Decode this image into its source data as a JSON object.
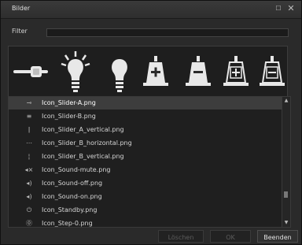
{
  "window": {
    "title": "Bilder"
  },
  "filter": {
    "label": "Filter",
    "value": ""
  },
  "icon_bar": {
    "icons": [
      "slider-handle-icon",
      "bulb-glowing-icon",
      "bulb-icon",
      "bell-plus-icon",
      "bell-minus-icon",
      "bell-plus-outline-icon",
      "bell-minus-outline-icon"
    ]
  },
  "files": [
    {
      "name": "Icon_Slider-A.png",
      "icon": "slider-a-icon",
      "glyph": "⊸",
      "selected": true
    },
    {
      "name": "Icon_Slider-B.png",
      "icon": "slider-b-icon",
      "glyph": "≡",
      "selected": false
    },
    {
      "name": "Icon_Slider_A_vertical.png",
      "icon": "slider-a-vertical-icon",
      "glyph": "ǀ",
      "selected": false
    },
    {
      "name": "Icon_Slider_B_horizontal.png",
      "icon": "slider-b-horizontal-icon",
      "glyph": "⋯",
      "selected": false
    },
    {
      "name": "Icon_Slider_B_vertical.png",
      "icon": "slider-b-vertical-icon",
      "glyph": "¦",
      "selected": false
    },
    {
      "name": "Icon_Sound-mute.png",
      "icon": "sound-mute-icon",
      "glyph": "◂×",
      "selected": false
    },
    {
      "name": "Icon_Sound-off.png",
      "icon": "sound-off-icon",
      "glyph": "◂)",
      "selected": false
    },
    {
      "name": "Icon_Sound-on.png",
      "icon": "sound-on-icon",
      "glyph": "◂)",
      "selected": false
    },
    {
      "name": "Icon_Standby.png",
      "icon": "standby-icon",
      "glyph": "⏻",
      "selected": false
    },
    {
      "name": "Icon_Step-0.png",
      "icon": "step-0-icon",
      "glyph": "⓪",
      "selected": false
    }
  ],
  "buttons": {
    "delete_label": "Löschen",
    "ok_label": "OK",
    "close_label": "Beenden"
  },
  "colors": {
    "background": "#2a2a2a",
    "list_bg": "#1f1f1f",
    "selected_row": "#3d3d3d",
    "icon_fill": "#e8e8e8"
  }
}
